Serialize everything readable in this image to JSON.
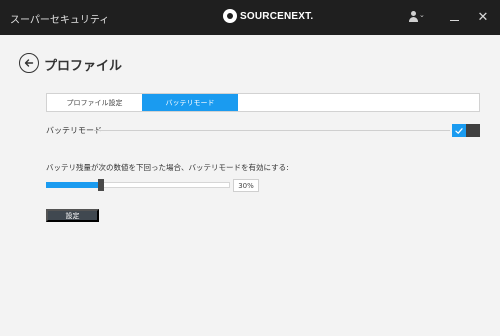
{
  "titlebar": {
    "app_name": "スーパーセキュリティ",
    "brand": "SOURCENEXT.",
    "user_icon": "user-icon",
    "minimize_icon": "minimize-icon",
    "close_icon": "close-icon"
  },
  "page": {
    "title": "プロファイル",
    "back_icon": "arrow-left-icon"
  },
  "tabs": [
    {
      "label": "プロファイル設定",
      "active": false
    },
    {
      "label": "バッテリモード",
      "active": true
    }
  ],
  "battery": {
    "section_label": "バッテリモード",
    "toggle_on": true,
    "threshold_label": "バッテリ残量が次の数値を下回った場合、バッテリモードを有効にする:",
    "threshold_percent": 30,
    "threshold_text": "30%",
    "settings_button": "設定"
  },
  "colors": {
    "accent": "#1a9bf0",
    "titlebar": "#1f1f1f",
    "background": "#f3f3f3",
    "button": "#404850"
  }
}
